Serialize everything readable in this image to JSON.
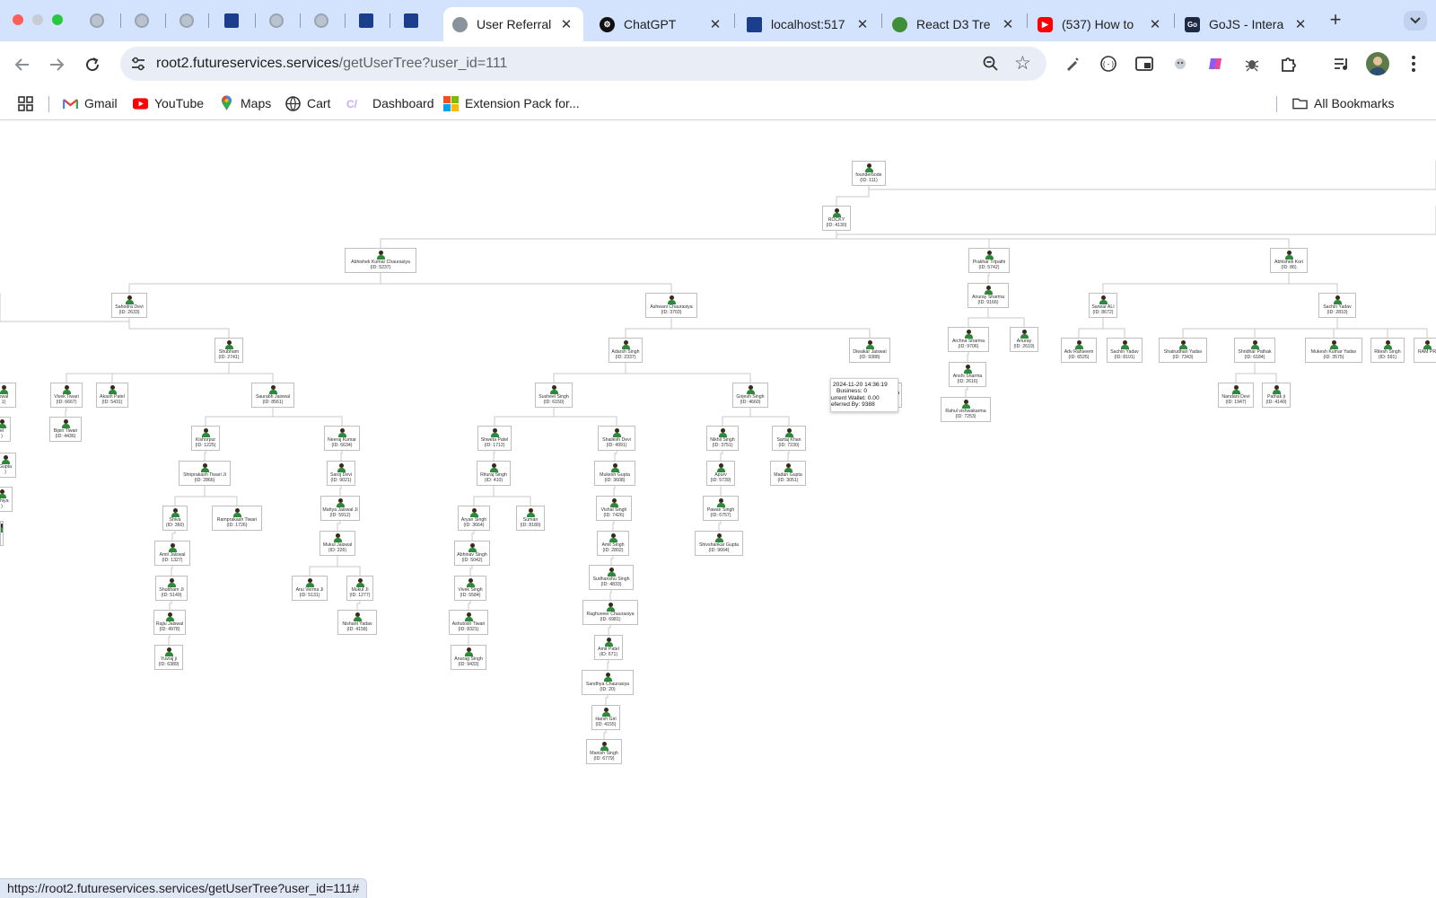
{
  "browser": {
    "tabs": [
      {
        "title": "User Referral",
        "favicon": "globe-icon",
        "active": true
      },
      {
        "title": "ChatGPT",
        "favicon": "chatgpt-icon"
      },
      {
        "title": "localhost:517",
        "favicon": "doc-icon"
      },
      {
        "title": "React D3 Tre",
        "favicon": "tree-icon"
      },
      {
        "title": "(537) How to",
        "favicon": "youtube-icon"
      },
      {
        "title": "GoJS - Intera",
        "favicon": "gojs-icon"
      }
    ],
    "new_tab_label": "+",
    "url_host": "root2.futureservices.services",
    "url_path": "/getUserTree?user_id=111",
    "bookmarks": [
      {
        "label": "Gmail",
        "icon": "gmail-icon"
      },
      {
        "label": "YouTube",
        "icon": "youtube-icon"
      },
      {
        "label": "Maps",
        "icon": "maps-icon"
      },
      {
        "label": "Cart",
        "icon": "globe-icon"
      },
      {
        "label": "Dashboard",
        "icon": "dashboard-icon"
      },
      {
        "label": "Extension Pack for...",
        "icon": "microsoft-icon"
      }
    ],
    "all_bookmarks_label": "All Bookmarks",
    "status_url": "https://root2.futureservices.services/getUserTree?user_id=111#"
  },
  "colors": {
    "chrome": "#d3e3fd",
    "avatar_body": "#2d8a3a",
    "link_line": "#c8c8c8"
  },
  "tree": {
    "nodes": [
      {
        "id": "n111",
        "name": "founderbode",
        "sub": "(ID: 111)"
      },
      {
        "id": "n4130",
        "name": "ROCKY",
        "sub": "(ID: 4130)"
      },
      {
        "id": "n5237",
        "name": "Abhishek Kumar Chaurasiya",
        "sub": "(ID: 5237)"
      },
      {
        "id": "n5742",
        "name": "Prakhar Tripathi",
        "sub": "(ID: 5742)"
      },
      {
        "id": "n86",
        "name": "Abhishek Kori",
        "sub": "(ID: 86)"
      },
      {
        "id": "n2633",
        "name": "Sahodra Devi",
        "sub": "(ID: 2633)"
      },
      {
        "id": "n3703",
        "name": "Ashwani Chaurasiya",
        "sub": "(ID: 3703)"
      },
      {
        "id": "n9166",
        "name": "Anuray Sharma",
        "sub": "(ID: 9166)"
      },
      {
        "id": "n8672",
        "name": "Sarwar ALI",
        "sub": "(ID: 8672)"
      },
      {
        "id": "n2810",
        "name": "Sachin Yadav",
        "sub": "(ID: 2810)"
      },
      {
        "id": "n2741",
        "name": "Shubham",
        "sub": "(ID: 2741)"
      },
      {
        "id": "n2337",
        "name": "Adarsh Singh",
        "sub": "(ID: 2337)"
      },
      {
        "id": "n9388",
        "name": "Diwakar Jaiswal",
        "sub": "(ID: 9388)"
      },
      {
        "id": "n9706",
        "name": "Archna Sharma",
        "sub": "(ID: 9706)"
      },
      {
        "id": "n2619",
        "name": "Anuray",
        "sub": "(ID: 2619)"
      },
      {
        "id": "n6525",
        "name": "Adv Rahseem",
        "sub": "(ID: 6525)"
      },
      {
        "id": "n8101",
        "name": "Sachin Yadav",
        "sub": "(ID: 8101)"
      },
      {
        "id": "n7343",
        "name": "Shatrudhan Yadav",
        "sub": "(ID: 7343)"
      },
      {
        "id": "n6184",
        "name": "Shridhar Pathak",
        "sub": "(ID: 6184)"
      },
      {
        "id": "n3575",
        "name": "Mukesh Kumar Yadav",
        "sub": "(ID: 3575)"
      },
      {
        "id": "n591",
        "name": "Ritesh Singh",
        "sub": "(ID: 591)"
      },
      {
        "id": "nramp",
        "name": "RAM PR",
        "sub": ""
      },
      {
        "id": "lw1",
        "name": "ewal",
        "sub": "1)"
      },
      {
        "id": "n6667",
        "name": "Vivek Tiwari",
        "sub": "(ID: 6667)"
      },
      {
        "id": "n5431",
        "name": "Akash Patel",
        "sub": "(ID: 5431)"
      },
      {
        "id": "n8561",
        "name": "Saurabh Jaiswal",
        "sub": "(ID: 8561)"
      },
      {
        "id": "n6150",
        "name": "Susheel Singh",
        "sub": "(ID: 6150)"
      },
      {
        "id": "n4660",
        "name": "Girjesh Singh",
        "sub": "(ID: 4660)"
      },
      {
        "id": "n2616",
        "name": "Anshi Sharma",
        "sub": "(ID: 2616)"
      },
      {
        "id": "n1947",
        "name": "Nandani Devi",
        "sub": "(ID: 1947)"
      },
      {
        "id": "n4140",
        "name": "Pathak ji",
        "sub": "(ID: 4140)"
      },
      {
        "id": "lw2",
        "name": "el",
        "sub": ")"
      },
      {
        "id": "n4436",
        "name": "Bipin Tiwari",
        "sub": "(ID: 4436)"
      },
      {
        "id": "n1225",
        "name": "Kishorpur",
        "sub": "(ID: 1225)"
      },
      {
        "id": "n6634",
        "name": "Neeraj Kumar",
        "sub": "(ID: 6634)"
      },
      {
        "id": "n1712",
        "name": "Shweta Patel",
        "sub": "(ID: 1712)"
      },
      {
        "id": "n4991",
        "name": "Shailesh Devi",
        "sub": "(ID: 4991)"
      },
      {
        "id": "n3751",
        "name": "Nikhil Singh",
        "sub": "(ID: 3751)"
      },
      {
        "id": "n7230",
        "name": "Sartaj Khan",
        "sub": "(ID: 7230)"
      },
      {
        "id": "n7253",
        "name": "Rahul vishwakarma",
        "sub": "(ID: 7253)"
      },
      {
        "id": "lw3",
        "name": "Gupta",
        "sub": ")"
      },
      {
        "id": "n2866",
        "name": "Shriprakash Tiwari Ji",
        "sub": "(ID: 2866)"
      },
      {
        "id": "n9021",
        "name": "Saroj Devi",
        "sub": "(ID: 9021)"
      },
      {
        "id": "n410",
        "name": "Rituraj Singh",
        "sub": "(ID: 410)"
      },
      {
        "id": "n3608",
        "name": "Mukesh Gupta",
        "sub": "(ID: 3608)"
      },
      {
        "id": "n5739",
        "name": "Apurv",
        "sub": "(ID: 5739)"
      },
      {
        "id": "n3051",
        "name": "Madan Gupta",
        "sub": "(ID: 3051)"
      },
      {
        "id": "lw4",
        "name": "chhiya",
        "sub": ")"
      },
      {
        "id": "n360",
        "name": "Shiva",
        "sub": "(ID: 360)"
      },
      {
        "id": "n1726",
        "name": "Ramprakash Tiwari",
        "sub": "(ID: 1726)"
      },
      {
        "id": "n5912",
        "name": "Mahya Jaiswal Ji",
        "sub": "(ID: 5912)"
      },
      {
        "id": "n3664",
        "name": "Aryan Singh",
        "sub": "(ID: 3664)"
      },
      {
        "id": "n8180",
        "name": "Suman",
        "sub": "(ID: 8180)"
      },
      {
        "id": "n7426",
        "name": "Vishal Singh",
        "sub": "(ID: 7426)"
      },
      {
        "id": "n6757",
        "name": "Pawan Singh",
        "sub": "(ID: 6757)"
      },
      {
        "id": "lw5",
        "name": "",
        "sub": ""
      },
      {
        "id": "n1327",
        "name": "Amit Jaiswal",
        "sub": "(ID: 1327)"
      },
      {
        "id": "n226",
        "name": "Mukul Jaiswal",
        "sub": "(ID: 226)"
      },
      {
        "id": "n5042",
        "name": "Abhinav Singh",
        "sub": "(ID: 5042)"
      },
      {
        "id": "n2802",
        "name": "Amit Singh",
        "sub": "(ID: 2802)"
      },
      {
        "id": "n9664",
        "name": "Shivshankar Gupta",
        "sub": "(ID: 9664)"
      },
      {
        "id": "n5149",
        "name": "Shubham Ji",
        "sub": "(ID: 5149)"
      },
      {
        "id": "n5131",
        "name": "Anu Verma Ji",
        "sub": "(ID: 5131)"
      },
      {
        "id": "n1277",
        "name": "Mukul Ji",
        "sub": "(ID: 1277)"
      },
      {
        "id": "n5584",
        "name": "Vivek Singh",
        "sub": "(ID: 5584)"
      },
      {
        "id": "n4833",
        "name": "Sudhanshu Singh",
        "sub": "(ID: 4833)"
      },
      {
        "id": "n4978",
        "name": "Rajiu Jaiswal",
        "sub": "(ID: 4978)"
      },
      {
        "id": "n4158",
        "name": "Nishant Yadav",
        "sub": "(ID: 4158)"
      },
      {
        "id": "n8321",
        "name": "Ashutosh Tiwari",
        "sub": "(ID: 8321)"
      },
      {
        "id": "n6981",
        "name": "Raghuveer Chaurasiya",
        "sub": "(ID: 6981)"
      },
      {
        "id": "n6389",
        "name": "Yuvraj ji",
        "sub": "(ID: 6389)"
      },
      {
        "id": "n9433",
        "name": "Anurag Singh",
        "sub": "(ID: 9433)"
      },
      {
        "id": "n671",
        "name": "Amit Patel",
        "sub": "(ID: 671)"
      },
      {
        "id": "n20",
        "name": "Sandhya Chaurasiya",
        "sub": "(ID: 20)"
      },
      {
        "id": "n4155",
        "name": "Harsh Giri",
        "sub": "(ID: 4155)"
      },
      {
        "id": "n6779",
        "name": "Manish Singh",
        "sub": "(ID: 6779)"
      },
      {
        "id": "hid",
        "name": "",
        "sub": "4)"
      }
    ],
    "tooltip": {
      "line1": "2024-11-20 14:36:19",
      "line2": "Business: 0",
      "line3": "urrent Wallet: 0.00",
      "line4": "eferred By: 9388"
    }
  }
}
